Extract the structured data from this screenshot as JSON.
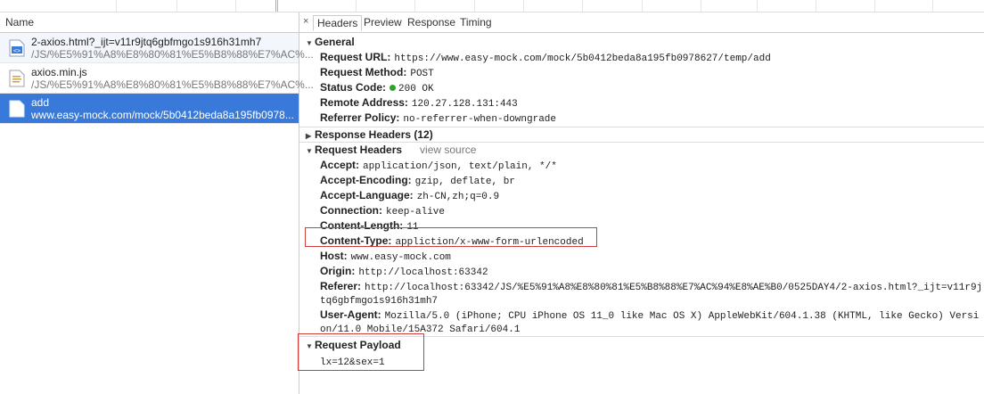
{
  "list": {
    "header": "Name",
    "requests": [
      {
        "name": "2-axios.html?_ijt=v11r9jtq6gbfmgo1s916h31mh7",
        "path": "/JS/%E5%91%A8%E8%80%81%E5%B8%88%E7%AC%...",
        "icon": "html-file-icon"
      },
      {
        "name": "axios.min.js",
        "path": "/JS/%E5%91%A8%E8%80%81%E5%B8%88%E7%AC%...",
        "icon": "script-file-icon"
      },
      {
        "name": "add",
        "path": "www.easy-mock.com/mock/5b0412beda8a195fb0978...",
        "icon": "document-icon"
      }
    ]
  },
  "tabs": {
    "close": "×",
    "items": [
      "Headers",
      "Preview",
      "Response",
      "Timing"
    ]
  },
  "general": {
    "title": "General",
    "request_url_k": "Request URL:",
    "request_url_v": "https://www.easy-mock.com/mock/5b0412beda8a195fb0978627/temp/add",
    "method_k": "Request Method:",
    "method_v": "POST",
    "status_k": "Status Code:",
    "status_v": "200 OK",
    "remote_k": "Remote Address:",
    "remote_v": "120.27.128.131:443",
    "referrer_k": "Referrer Policy:",
    "referrer_v": "no-referrer-when-downgrade"
  },
  "response_headers": {
    "title": "Response Headers (12)"
  },
  "request_headers": {
    "title": "Request Headers",
    "view_source": "view source",
    "accept_k": "Accept:",
    "accept_v": "application/json, text/plain, */*",
    "encoding_k": "Accept-Encoding:",
    "encoding_v": "gzip, deflate, br",
    "language_k": "Accept-Language:",
    "language_v": "zh-CN,zh;q=0.9",
    "connection_k": "Connection:",
    "connection_v": "keep-alive",
    "length_k": "Content-Length:",
    "length_v": "11",
    "ctype_k": "Content-Type:",
    "ctype_v": "appliction/x-www-form-urlencoded",
    "host_k": "Host:",
    "host_v": "www.easy-mock.com",
    "origin_k": "Origin:",
    "origin_v": "http://localhost:63342",
    "referer_k": "Referer:",
    "referer_v1": "http://localhost:63342/JS/%E5%91%A8%E8%80%81%E5%B8%88%E7%AC%94%E8%AE%B0/0525DAY4/2-axios.html?_ijt=v11r9j",
    "referer_v2": "tq6gbfmgo1s916h31mh7",
    "ua_k": "User-Agent:",
    "ua_v1": "Mozilla/5.0 (iPhone; CPU iPhone OS 11_0 like Mac OS X) AppleWebKit/604.1.38 (KHTML, like Gecko) Versi",
    "ua_v2": "on/11.0 Mobile/15A372 Safari/604.1"
  },
  "payload": {
    "title": "Request Payload",
    "value": "lx=12&sex=1"
  },
  "colors": {
    "selected": "#3879d9",
    "highlight": "#cf3d3d",
    "status_ok": "#2aa52a"
  }
}
